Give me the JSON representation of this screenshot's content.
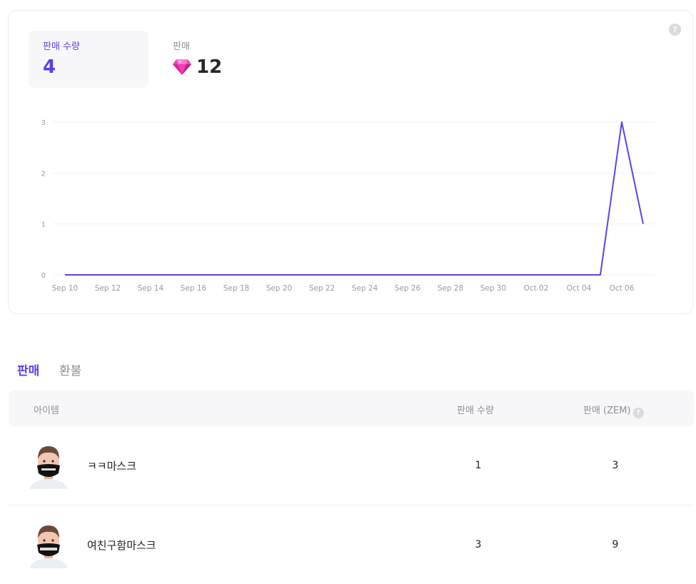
{
  "stats": {
    "quantity_label": "판매 수량",
    "quantity_value": "4",
    "sales_label": "판매",
    "sales_value": "12"
  },
  "help_icon_text": "?",
  "chart_data": {
    "type": "line",
    "x_tick_labels": [
      "Sep 10",
      "Sep 12",
      "Sep 14",
      "Sep 16",
      "Sep 18",
      "Sep 20",
      "Sep 22",
      "Sep 24",
      "Sep 26",
      "Sep 28",
      "Sep 30",
      "Oct 02",
      "Oct 04",
      "Oct 06"
    ],
    "y_tick_labels": [
      "0",
      "1",
      "2",
      "3"
    ],
    "ylim": [
      0,
      3
    ],
    "grid": true,
    "color": "#5b45e0",
    "x": [
      "Sep 10",
      "Oct 05",
      "Oct 06",
      "Oct 07"
    ],
    "values": [
      0,
      0,
      3,
      1
    ]
  },
  "tabs": {
    "sales": "판매",
    "refund": "환불"
  },
  "table": {
    "headers": {
      "item": "아이템",
      "quantity": "판매 수량",
      "zem": "판매 (ZEM)"
    },
    "rows": [
      {
        "name": "ㅋㅋ마스크",
        "quantity": "1",
        "zem": "3"
      },
      {
        "name": "여친구함마스크",
        "quantity": "3",
        "zem": "9"
      }
    ]
  },
  "colors": {
    "accent": "#5a3fe6",
    "gem": "#f03eb5",
    "muted": "#8e8e96"
  }
}
